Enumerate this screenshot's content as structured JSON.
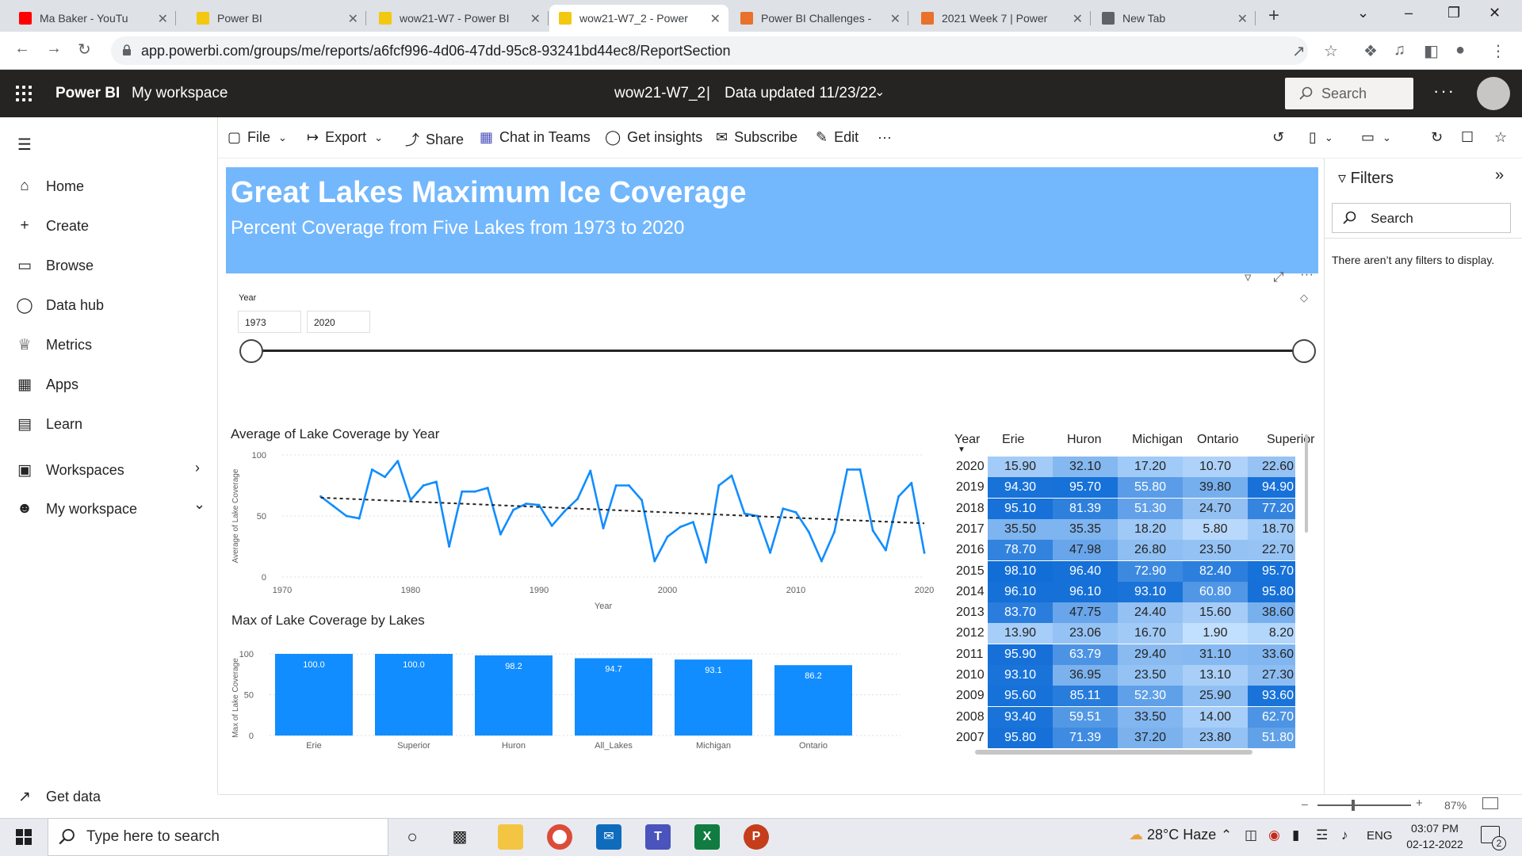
{
  "browser": {
    "tabs": [
      {
        "title": "Ma Baker - YouTu",
        "favicon_color": "#ff0000",
        "active": false
      },
      {
        "title": "Power BI",
        "favicon_color": "#f2c811",
        "active": false
      },
      {
        "title": "wow21-W7 - Power BI",
        "favicon_color": "#f2c811",
        "active": false
      },
      {
        "title": "wow21-W7_2 - Power",
        "favicon_color": "#f2c811",
        "active": true
      },
      {
        "title": "Power BI Challenges -",
        "favicon_color": "#e8712c",
        "active": false
      },
      {
        "title": "2021 Week 7 | Power",
        "favicon_color": "#e8712c",
        "active": false
      },
      {
        "title": "New Tab",
        "favicon_color": "#5f6368",
        "active": false
      }
    ],
    "url": "app.powerbi.com/groups/me/reports/a6fcf996-4d06-47dd-95c8-93241bd44ec8/ReportSection"
  },
  "pbi_header": {
    "app_name": "Power BI",
    "workspace": "My workspace",
    "report_name": "wow21-W7_2",
    "separator": "|",
    "data_updated": "Data updated 11/23/22",
    "search_placeholder": "Search",
    "more": "···"
  },
  "left_nav": {
    "items": [
      {
        "label": "Home",
        "icon": "home-icon",
        "glyph": "⌂"
      },
      {
        "label": "Create",
        "icon": "plus-icon",
        "glyph": "+"
      },
      {
        "label": "Browse",
        "icon": "folder-icon",
        "glyph": "▭"
      },
      {
        "label": "Data hub",
        "icon": "database-icon",
        "glyph": "◯"
      },
      {
        "label": "Metrics",
        "icon": "trophy-icon",
        "glyph": "♕"
      },
      {
        "label": "Apps",
        "icon": "apps-icon",
        "glyph": "▦"
      },
      {
        "label": "Learn",
        "icon": "book-icon",
        "glyph": "▤"
      }
    ],
    "workspaces": "Workspaces",
    "my_workspace": "My workspace",
    "get_data": "Get data"
  },
  "action_bar": {
    "file": "File",
    "export": "Export",
    "share": "Share",
    "chat_in_teams": "Chat in Teams",
    "get_insights": "Get insights",
    "subscribe": "Subscribe",
    "edit": "Edit",
    "more": "···"
  },
  "report": {
    "title": "Great Lakes Maximum Ice Coverage",
    "subtitle": "Percent Coverage from Five Lakes from 1973 to 2020",
    "slicer": {
      "label": "Year",
      "start": "1973",
      "end": "2020",
      "range": [
        1973,
        2020
      ]
    }
  },
  "chart_data": [
    {
      "type": "line",
      "title": "Average of Lake Coverage by Year",
      "xlabel": "Year",
      "ylabel": "Average of Lake Coverage",
      "xlim": [
        1970,
        2020
      ],
      "ylim": [
        0,
        100
      ],
      "xticks": [
        "1970",
        "1980",
        "1990",
        "2000",
        "2010",
        "2020"
      ],
      "yticks": [
        "0",
        "50",
        "100"
      ],
      "trendline": true,
      "trend": {
        "x": [
          1973,
          2020
        ],
        "y": [
          65,
          44
        ]
      },
      "series": [
        {
          "x": [
            1973,
            1974,
            1975,
            1976,
            1977,
            1978,
            1979,
            1980,
            1981,
            1982,
            1983,
            1984,
            1985,
            1986,
            1987,
            1988,
            1989,
            1990,
            1991,
            1992,
            1993,
            1994,
            1995,
            1996,
            1997,
            1998,
            1999,
            2000,
            2001,
            2002,
            2003,
            2004,
            2005,
            2006,
            2007,
            2008,
            2009,
            2010,
            2011,
            2012,
            2013,
            2014,
            2015,
            2016,
            2017,
            2018,
            2019,
            2020
          ],
          "y": [
            66,
            58,
            50,
            48,
            88,
            82,
            95,
            63,
            75,
            78,
            25,
            70,
            70,
            73,
            35,
            55,
            60,
            59,
            42,
            54,
            64,
            87,
            40,
            75,
            75,
            63,
            13,
            33,
            41,
            45,
            12,
            75,
            83,
            52,
            50,
            20,
            56,
            53,
            37,
            13,
            37,
            88,
            88,
            38,
            22,
            66,
            77,
            20
          ]
        }
      ]
    },
    {
      "type": "bar",
      "title": "Max of Lake Coverage by Lakes",
      "xlabel": "",
      "ylabel": "Max of Lake Coverage",
      "ylim": [
        0,
        100
      ],
      "yticks": [
        "0",
        "50",
        "100"
      ],
      "categories": [
        "Erie",
        "Superior",
        "Huron",
        "All_Lakes",
        "Michigan",
        "Ontario"
      ],
      "values": [
        100.0,
        100.0,
        98.2,
        94.7,
        93.1,
        86.2
      ],
      "labels": [
        "100.0",
        "100.0",
        "98.2",
        "94.7",
        "93.1",
        "86.2"
      ]
    },
    {
      "type": "table",
      "columns": [
        "Year",
        "Erie",
        "Huron",
        "Michigan",
        "Ontario",
        "Superior"
      ],
      "rows": [
        [
          "2020",
          "15.90",
          "32.10",
          "17.20",
          "10.70",
          "22.60"
        ],
        [
          "2019",
          "94.30",
          "95.70",
          "55.80",
          "39.80",
          "94.90"
        ],
        [
          "2018",
          "95.10",
          "81.39",
          "51.30",
          "24.70",
          "77.20"
        ],
        [
          "2017",
          "35.50",
          "35.35",
          "18.20",
          "5.80",
          "18.70"
        ],
        [
          "2016",
          "78.70",
          "47.98",
          "26.80",
          "23.50",
          "22.70"
        ],
        [
          "2015",
          "98.10",
          "96.40",
          "72.90",
          "82.40",
          "95.70"
        ],
        [
          "2014",
          "96.10",
          "96.10",
          "93.10",
          "60.80",
          "95.80"
        ],
        [
          "2013",
          "83.70",
          "47.75",
          "24.40",
          "15.60",
          "38.60"
        ],
        [
          "2012",
          "13.90",
          "23.06",
          "16.70",
          "1.90",
          "8.20"
        ],
        [
          "2011",
          "95.90",
          "63.79",
          "29.40",
          "31.10",
          "33.60"
        ],
        [
          "2010",
          "93.10",
          "36.95",
          "23.50",
          "13.10",
          "27.30"
        ],
        [
          "2009",
          "95.60",
          "85.11",
          "52.30",
          "25.90",
          "93.60"
        ],
        [
          "2008",
          "93.40",
          "59.51",
          "33.50",
          "14.00",
          "62.70"
        ],
        [
          "2007",
          "95.80",
          "71.39",
          "37.20",
          "23.80",
          "51.80"
        ]
      ]
    }
  ],
  "filters_pane": {
    "title": "Filters",
    "search_placeholder": "Search",
    "empty_text": "There aren’t any filters to display."
  },
  "zoom": {
    "percent": "87%",
    "level": 0.87
  },
  "taskbar": {
    "search_placeholder": "Type here to search",
    "weather": "28°C  Haze",
    "language": "ENG",
    "time": "03:07 PM",
    "date": "02-12-2022",
    "notifications": "2"
  },
  "colors": {
    "banner": "#73b8fd",
    "line": "#118dff",
    "bar": "#118dff",
    "header": "#252423",
    "heat_low": "#c6e2ff",
    "heat_high": "#0f6cd6"
  }
}
